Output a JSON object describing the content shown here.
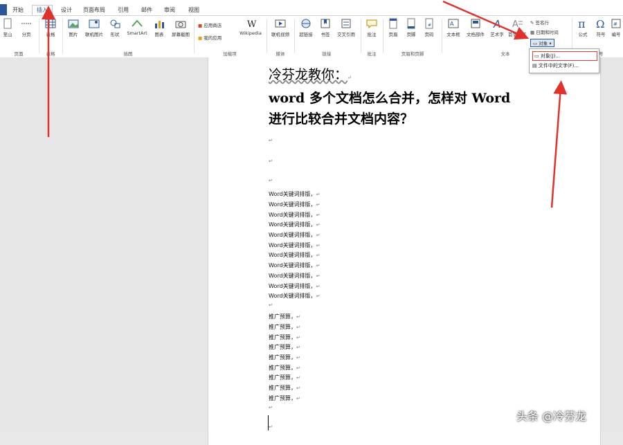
{
  "tabs": {
    "home": "开始",
    "insert": "插入",
    "design": "设计",
    "layout": "页面布局",
    "refs": "引用",
    "mail": "邮件",
    "review": "审阅",
    "view": "视图"
  },
  "ribbon": {
    "b_cover": "至山",
    "b_blank": "分页",
    "b_table": "表格",
    "b_picture": "图片",
    "b_online_pic": "联机图片",
    "b_shapes": "形状",
    "b_smartart": "SmartArt",
    "b_chart": "图表",
    "b_screenshot": "屏幕截图",
    "b_store": "应用商店",
    "b_myapps": "我的应用",
    "b_wiki": "Wikipedia",
    "b_video": "联机视频",
    "b_link": "超链接",
    "b_bookmark": "书签",
    "b_crossref": "交叉引用",
    "b_comment": "批注",
    "b_header": "页眉",
    "b_footer": "页脚",
    "b_pagenum": "页码",
    "b_textbox": "文本框",
    "b_quickparts": "文档部件",
    "b_wordart": "艺术字",
    "b_dropcap": "首字下沉",
    "b_sigline": "签名行",
    "b_datetime": "日期和时间",
    "b_object": "对象",
    "b_equation": "公式",
    "b_symbol": "符号",
    "b_num": "编号",
    "g_pages": "页面",
    "g_tables": "表格",
    "g_illus": "插图",
    "g_addins": "加载项",
    "g_media": "媒体",
    "g_links": "链接",
    "g_comments": "批注",
    "g_headfoot": "页眉和页脚",
    "g_text": "文本",
    "g_symbols": "符号"
  },
  "dropdown": {
    "item1": "对象(J)...",
    "item2": "文件中的文字(F)..."
  },
  "doc": {
    "title_line1": "冷芬龙教你：",
    "title_line2": "word 多个文档怎么合并，怎样对 Word",
    "title_line3": "进行比较合并文档内容？",
    "para_mark": "↵",
    "line_word": "Word关键词排版，",
    "line_promo": "推广预算，"
  },
  "watermark": "头条 @冷芬龙"
}
